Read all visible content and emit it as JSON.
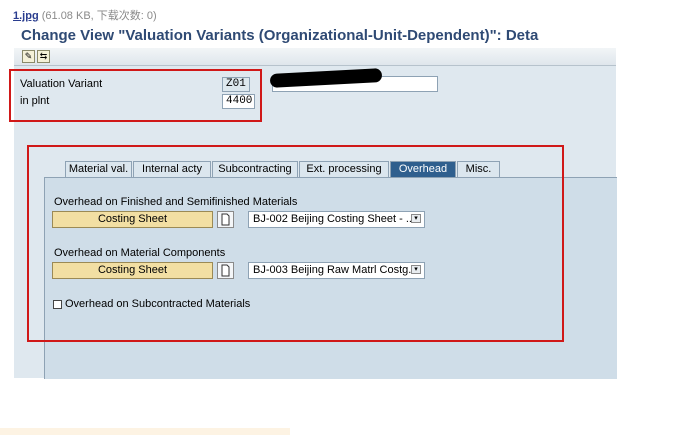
{
  "caption": {
    "file_name": "1.jpg",
    "meta": "(61.08 KB, 下载次数: 0)"
  },
  "window": {
    "title": "Change View \"Valuation Variants (Organizational-Unit-Dependent)\": Deta"
  },
  "toolbar": {
    "icons": [
      "edit-icon",
      "other-object-icon"
    ]
  },
  "header": {
    "valuation_variant_label": "Valuation Variant",
    "valuation_variant_value": "Z01",
    "plant_label": "in plnt",
    "plant_value": "4400"
  },
  "tabs": [
    {
      "label": "Material val."
    },
    {
      "label": "Internal acty"
    },
    {
      "label": "Subcontracting"
    },
    {
      "label": "Ext. processing"
    },
    {
      "label": "Overhead",
      "active": true
    },
    {
      "label": "Misc."
    }
  ],
  "overhead": {
    "finished_group_label": "Overhead on Finished and Semifinished Materials",
    "finished_button_label": "Costing Sheet",
    "finished_value": "BJ-002 Beijing Costing Sheet - ..",
    "components_group_label": "Overhead on Material Components",
    "components_button_label": "Costing Sheet",
    "components_value": "BJ-003 Beijing Raw Matrl Costg..",
    "subcontracted_checkbox_label": "Overhead on Subcontracted Materials",
    "subcontracted_checked": false
  },
  "colors": {
    "annotation_red": "#d01818",
    "active_tab": "#2f5f8e",
    "title": "#2f4a74"
  }
}
